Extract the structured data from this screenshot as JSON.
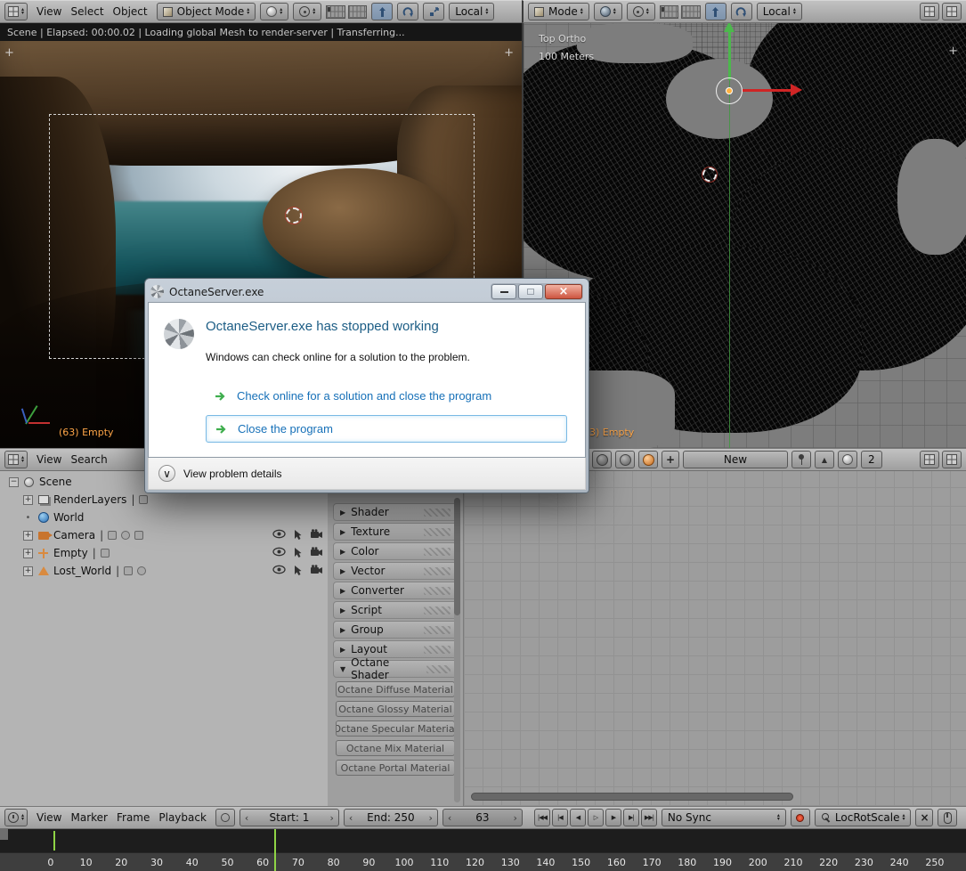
{
  "colors": {
    "header_bg": "#b1b1b1",
    "accent_blue": "#4a7fc1",
    "dialog_heading_blue": "#1c5d85",
    "link_blue": "#1670b8",
    "arrow_green": "#3fae4e",
    "selection_orange": "#ffa648",
    "frame_line_green": "#8fd445"
  },
  "viewport_left": {
    "header": {
      "editor_icon": "viewport-editor-icon",
      "menus": [
        "View",
        "Select",
        "Object"
      ],
      "mode_select": "Object Mode",
      "orientation_select": "Local",
      "icons": [
        "mode-cube-icon",
        "shading-sphere-icon",
        "pivot-center-icon",
        "layers-grid-icon",
        "translate-manipulator-icon",
        "rotate-manipulator-icon",
        "scale-manipulator-icon"
      ]
    },
    "status_bar": "Scene | Elapsed: 00:00.02 | Loading global Mesh to render-server | Transferring...",
    "object_label": "(63) Empty"
  },
  "viewport_right": {
    "header": {
      "mode_select": "Mode",
      "orientation_select": "Local",
      "icons": [
        "shading-globe-icon",
        "pivot-center-icon",
        "layers-grid-icon",
        "translate-manipulator-icon",
        "rotate-manipulator-icon",
        "screen-icon",
        "new-window-icon"
      ]
    },
    "view_label": "Top Ortho",
    "scale_label": "100 Meters",
    "object_label": "3) Empty"
  },
  "crash_dialog": {
    "title": "OctaneServer.exe",
    "window_buttons": [
      "minimize-icon",
      "maximize-icon",
      "close-icon"
    ],
    "heading": "OctaneServer.exe has stopped working",
    "message": "Windows can check online for a solution to the problem.",
    "option_online": "Check online for a solution and close the program",
    "option_close": "Close the program",
    "details_toggle": "View problem details"
  },
  "outliner": {
    "header_menus": [
      "View",
      "Search"
    ],
    "rows": [
      {
        "name": "Scene",
        "icon": "scene-icon",
        "expander": "minus"
      },
      {
        "name": "RenderLayers",
        "icon": "renderlayers-icon",
        "expander": "plus",
        "suffix": "|",
        "trailing_icons": [
          "render-toggle-icon"
        ]
      },
      {
        "name": "World",
        "icon": "world-icon",
        "expander": "dot"
      },
      {
        "name": "Camera",
        "icon": "camera-object-icon",
        "expander": "plus",
        "suffix": "|",
        "trailing_icons": [
          "animation-icon",
          "camera-data-icon",
          "constraint-icon"
        ],
        "toggles": [
          "eye-icon",
          "pointer-icon",
          "camera-render-icon"
        ]
      },
      {
        "name": "Empty",
        "icon": "empty-icon",
        "expander": "plus",
        "suffix": "|",
        "trailing_icons": [
          "animation-icon"
        ],
        "toggles": [
          "eye-icon",
          "pointer-icon",
          "camera-render-icon"
        ]
      },
      {
        "name": "Lost_World",
        "icon": "mesh-icon",
        "expander": "plus",
        "suffix": "|",
        "trailing_icons": [
          "modifier-icon",
          "vertexgroup-icon"
        ],
        "toggles": [
          "eye-icon",
          "pointer-icon",
          "camera-render-icon"
        ]
      }
    ]
  },
  "node_editor": {
    "header": {
      "icons": [
        "material-type-icon",
        "texture-type-icon",
        "world-type-icon",
        "add-icon",
        "pin-icon",
        "browse-up-icon",
        "material-preview-icon",
        "screen-icon",
        "new-window-icon"
      ],
      "new_button": "New",
      "users_count": "2"
    },
    "shelf_panels": [
      "Shader",
      "Texture",
      "Color",
      "Vector",
      "Converter",
      "Script",
      "Group",
      "Layout"
    ],
    "octane_panel_title": "Octane Shader",
    "octane_buttons": [
      "Octane Diffuse Material",
      "Octane Glossy Material",
      "Octane Specular Material",
      "Octane Mix Material",
      "Octane Portal Material"
    ]
  },
  "timeline": {
    "menus": [
      "View",
      "Marker",
      "Frame",
      "Playback"
    ],
    "start_field": "Start: 1",
    "end_field": "End: 250",
    "current_frame": "63",
    "playback_icons": [
      "jump-start-icon",
      "jump-prev-key-icon",
      "step-back-icon",
      "play-reverse-icon",
      "play-icon",
      "jump-next-key-icon",
      "jump-end-icon"
    ],
    "sync_select": "No Sync",
    "record_icon": "record-icon",
    "keying_set": "LocRotScale",
    "ruler_labels": [
      "0",
      "10",
      "20",
      "30",
      "40",
      "50",
      "60",
      "70",
      "80",
      "90",
      "100",
      "110",
      "120",
      "130",
      "140",
      "150",
      "160",
      "170",
      "180",
      "190",
      "200",
      "210",
      "220",
      "230",
      "240",
      "250"
    ]
  }
}
